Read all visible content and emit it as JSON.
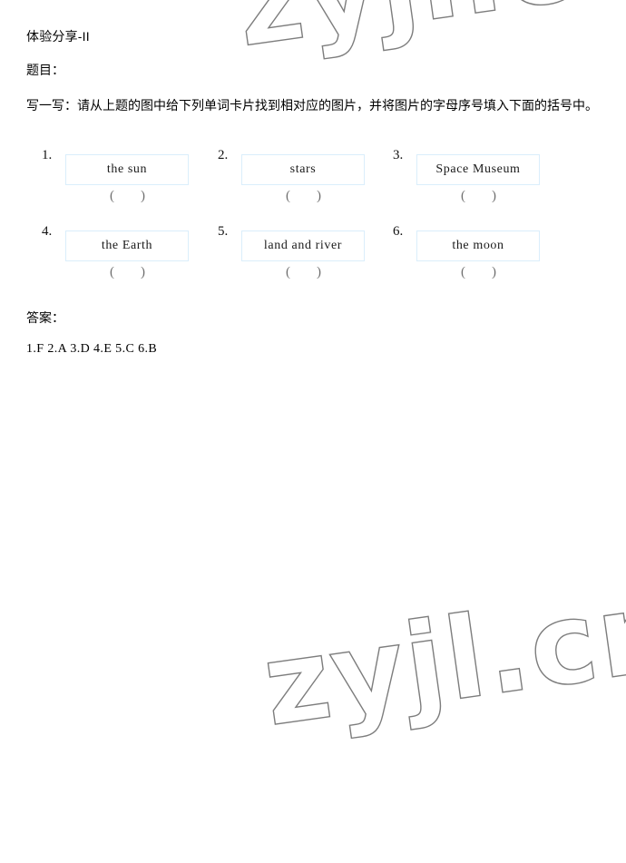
{
  "document": {
    "title": "体验分享-II",
    "section_label": "题目：",
    "instruction": "写一写：请从上题的图中给下列单词卡片找到相对应的图片，并将图片的字母序号填入下面的括号中。",
    "answer_label": "答案：",
    "answer_text": "1.F  2.A 3.D 4.E 5.C 6.B"
  },
  "watermark": {
    "text": "zyjl.cn",
    "color": "#7d7d7d"
  },
  "exercise": {
    "card_border_color": "#daeefb",
    "blank": "(          )",
    "rows": [
      [
        {
          "number": "1.",
          "word": "the sun",
          "blank_open": "(",
          "blank_close": ")"
        },
        {
          "number": "2.",
          "word": "stars",
          "blank_open": "(",
          "blank_close": ")"
        },
        {
          "number": "3.",
          "word": "Space  Museum",
          "blank_open": "(",
          "blank_close": ")"
        }
      ],
      [
        {
          "number": "4.",
          "word": "the  Earth",
          "blank_open": "(",
          "blank_close": ")"
        },
        {
          "number": "5.",
          "word": "land  and  river",
          "blank_open": "(",
          "blank_close": ")"
        },
        {
          "number": "6.",
          "word": "the  moon",
          "blank_open": "(",
          "blank_close": ")"
        }
      ]
    ]
  }
}
